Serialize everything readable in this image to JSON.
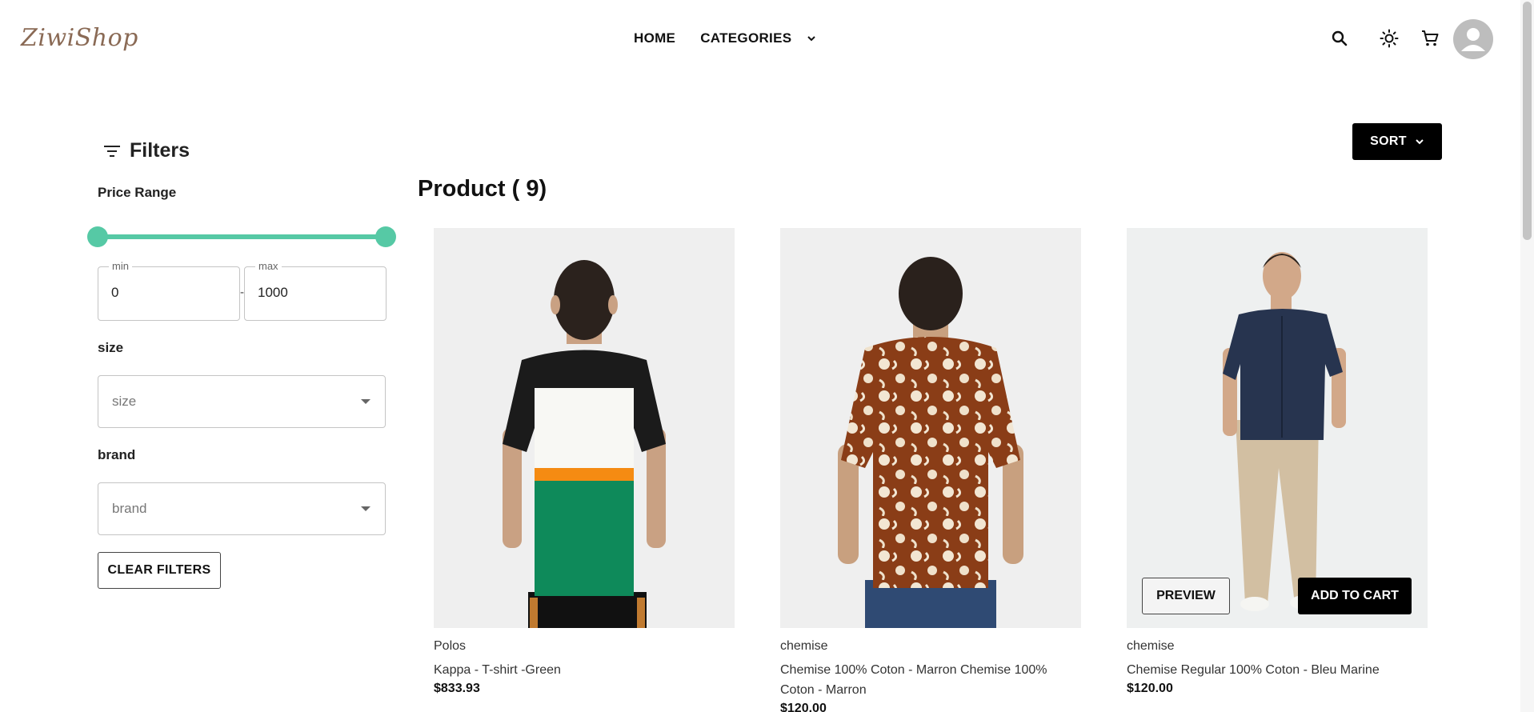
{
  "header": {
    "logo": "ZiwiShop",
    "nav": {
      "home": "HOME",
      "categories": "CATEGORIES"
    },
    "icons": [
      "search-icon",
      "theme-toggle-icon",
      "cart-icon",
      "avatar"
    ]
  },
  "filters": {
    "title": "Filters",
    "price_range": {
      "label": "Price Range",
      "min_label": "min",
      "max_label": "max",
      "min_value": "0",
      "max_value": "1000",
      "separator": "-"
    },
    "size": {
      "label": "size",
      "placeholder": "size"
    },
    "brand": {
      "label": "brand",
      "placeholder": "brand"
    },
    "clear_label": "CLEAR FILTERS"
  },
  "main": {
    "sort_label": "SORT",
    "heading": "Product ( 9)",
    "products": [
      {
        "category": "Polos",
        "name": "Kappa - T-shirt -Green",
        "price": "$833.93"
      },
      {
        "category": "chemise",
        "name": "Chemise 100% Coton - Marron Chemise 100% Coton - Marron",
        "price": "$120.00"
      },
      {
        "category": "chemise",
        "name": "Chemise Regular 100% Coton - Bleu Marine",
        "price": "$120.00",
        "preview_label": "PREVIEW",
        "add_to_cart_label": "ADD TO CART"
      }
    ]
  },
  "colors": {
    "accent": "#56c9a5",
    "logo": "#8a6a55",
    "primary_button": "#000000"
  }
}
